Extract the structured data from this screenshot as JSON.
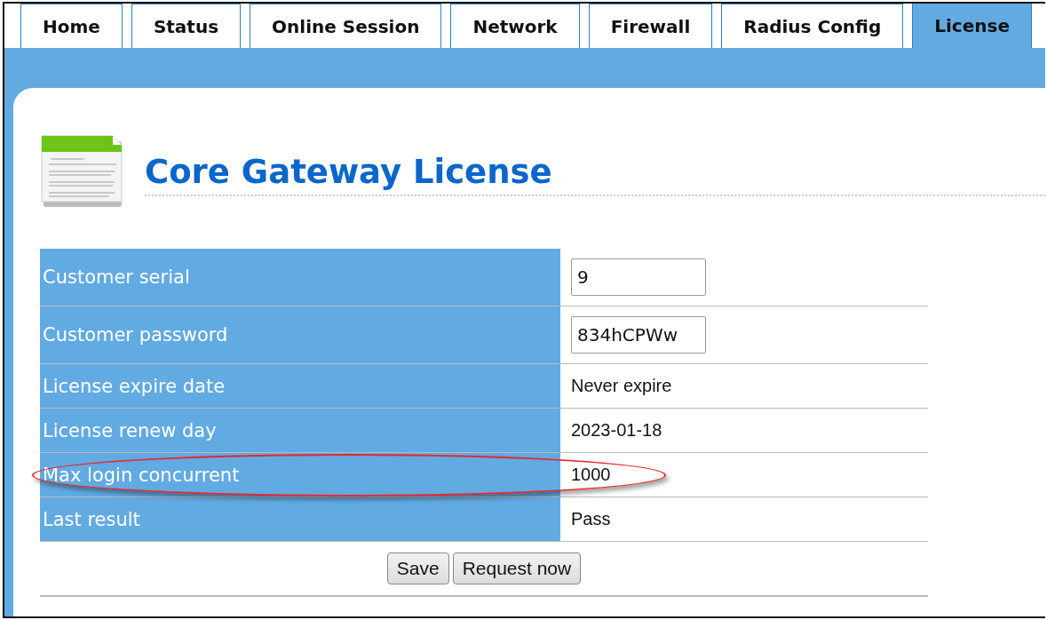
{
  "tabs": [
    {
      "label": "Home",
      "selected": false
    },
    {
      "label": "Status",
      "selected": false
    },
    {
      "label": "Online Session",
      "selected": false
    },
    {
      "label": "Network",
      "selected": false
    },
    {
      "label": "Firewall",
      "selected": false
    },
    {
      "label": "Radius Config",
      "selected": false
    },
    {
      "label": "License",
      "selected": true
    }
  ],
  "page_title": "Core Gateway License",
  "rows": [
    {
      "label": "Customer serial",
      "kind": "input",
      "value": "9",
      "circled": false
    },
    {
      "label": "Customer password",
      "kind": "input",
      "value": "834hCPWw",
      "circled": false
    },
    {
      "label": "License expire date",
      "kind": "text",
      "value": "Never expire",
      "circled": false
    },
    {
      "label": "License renew day",
      "kind": "text",
      "value": "2023-01-18",
      "circled": false
    },
    {
      "label": "Max login concurrent",
      "kind": "text",
      "value": "1000",
      "circled": true
    },
    {
      "label": "Last result",
      "kind": "text",
      "value": "Pass",
      "circled": false
    }
  ],
  "buttons": [
    "Save",
    "Request now"
  ]
}
